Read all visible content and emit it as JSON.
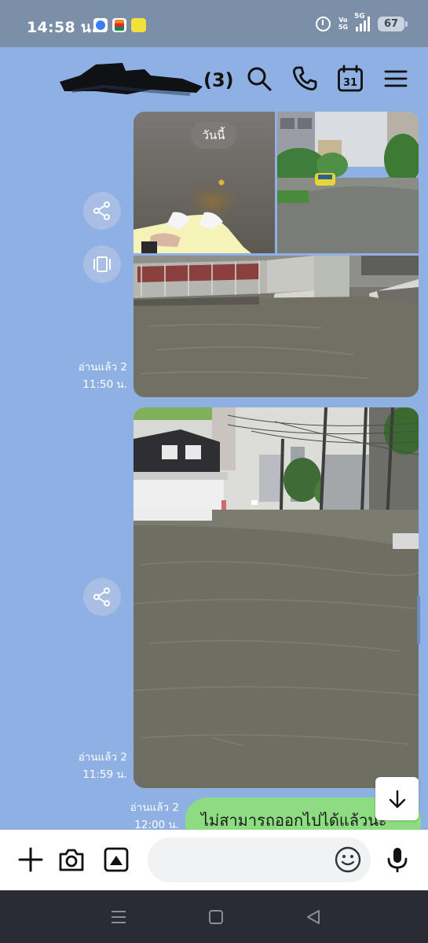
{
  "status_bar": {
    "time": "14:58 น.",
    "notifications": [
      "messenger-icon",
      "seven-eleven-icon",
      "lineman-icon"
    ],
    "volte_label_top": "Vo",
    "volte_label_bottom": "5G",
    "network": "5G",
    "battery": "67"
  },
  "header": {
    "group_name": "",
    "member_count": "(3)",
    "icons": [
      "search-icon",
      "phone-icon",
      "calendar-icon",
      "menu-icon"
    ],
    "calendar_day": "31"
  },
  "chat": {
    "date_chip": "วันนี้",
    "messages": [
      {
        "read_label": "อ่านแล้ว 2",
        "time": "11:50 น."
      },
      {
        "read_label": "อ่านแล้ว 2",
        "time": "11:59 น."
      },
      {
        "read_label": "อ่านแล้ว 2",
        "time": "12:00 น.",
        "text": "ไม่สามารถออกไปได้แล้วนะ"
      }
    ],
    "photo_descriptions": [
      "feet-in-floodwater",
      "flooded-street-with-car",
      "flooded-walkway",
      "flooded-soi"
    ]
  },
  "input_bar": {
    "placeholder": "",
    "icons": [
      "plus-icon",
      "camera-icon",
      "gallery-icon",
      "emoji-icon",
      "microphone-icon"
    ]
  },
  "nav_bar": {
    "icons": [
      "recent-apps-icon",
      "home-icon",
      "back-icon"
    ]
  },
  "colors": {
    "chat_background": "#8fb0e3",
    "my_bubble": "#8edc82",
    "status_bar": "#7b8fa9",
    "nav_bar": "#2a2c34"
  }
}
